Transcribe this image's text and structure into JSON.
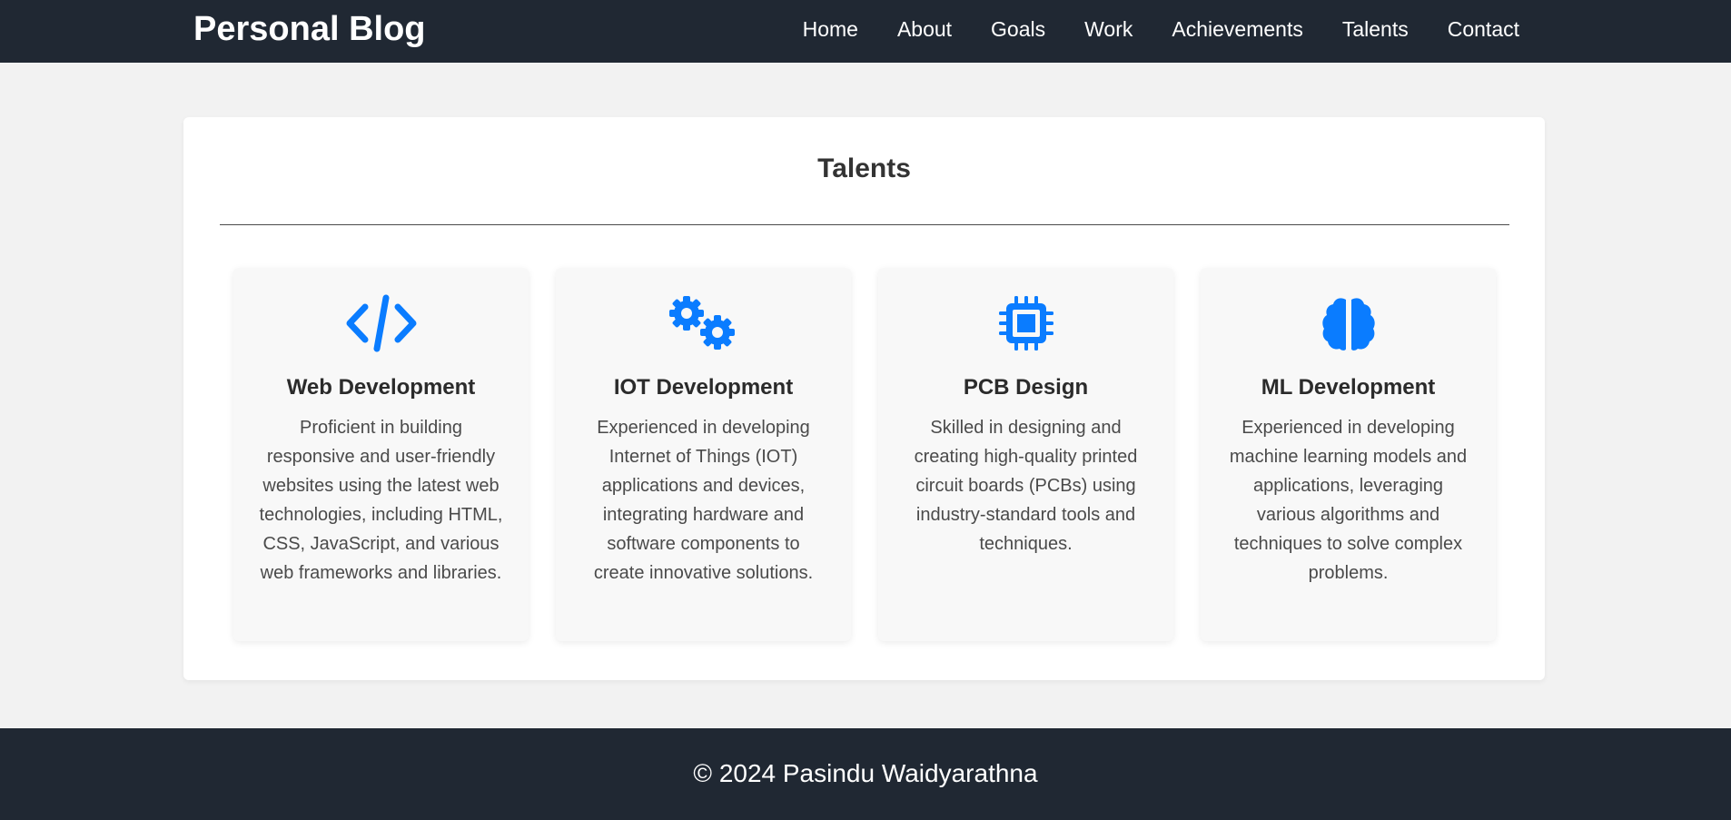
{
  "header": {
    "brand": "Personal Blog",
    "nav": [
      "Home",
      "About",
      "Goals",
      "Work",
      "Achievements",
      "Talents",
      "Contact"
    ]
  },
  "section": {
    "title": "Talents"
  },
  "talents": [
    {
      "icon": "code-icon",
      "title": "Web Development",
      "description": "Proficient in building responsive and user-friendly websites using the latest web technologies, including HTML, CSS, JavaScript, and various web frameworks and libraries."
    },
    {
      "icon": "gears-icon",
      "title": "IOT Development",
      "description": "Experienced in developing Internet of Things (IOT) applications and devices, integrating hardware and software components to create innovative solutions."
    },
    {
      "icon": "microchip-icon",
      "title": "PCB Design",
      "description": "Skilled in designing and creating high-quality printed circuit boards (PCBs) using industry-standard tools and techniques."
    },
    {
      "icon": "brain-icon",
      "title": "ML Development",
      "description": "Experienced in developing machine learning models and applications, leveraging various algorithms and techniques to solve complex problems."
    }
  ],
  "footer": {
    "copyright": "© 2024 Pasindu Waidyarathna"
  },
  "colors": {
    "header_bg": "#202833",
    "accent": "#0a7cff",
    "page_bg": "#f2f2f2"
  }
}
